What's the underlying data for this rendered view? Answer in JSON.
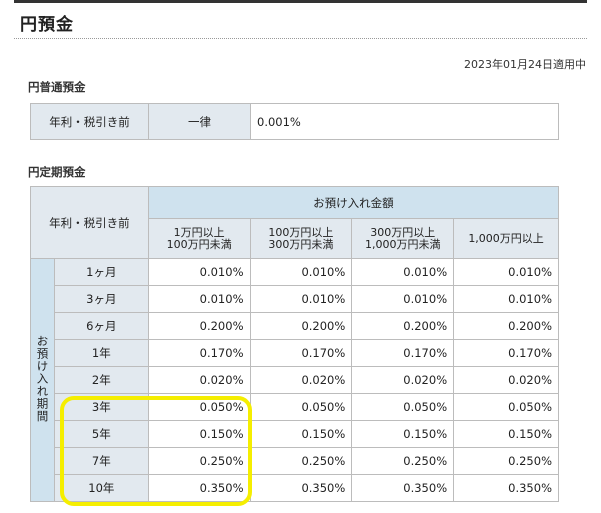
{
  "page": {
    "title": "円預金",
    "as_of": "2023年01月24日適用中"
  },
  "futsuu": {
    "heading": "円普通預金",
    "label": "年利・税引き前",
    "uniform_label": "一律",
    "rate": "0.001%"
  },
  "teiki": {
    "heading": "円定期預金",
    "header_label": "年利・税引き前",
    "amount_header": "お預け入れ金額",
    "period_label": "お預け入れ期間",
    "columns": [
      {
        "line1": "1万円以上",
        "line2": "100万円未満"
      },
      {
        "line1": "100万円以上",
        "line2": "300万円未満"
      },
      {
        "line1": "300万円以上",
        "line2": "1,000万円未満"
      },
      {
        "line1": "1,000万円以上",
        "line2": ""
      }
    ],
    "rows": [
      {
        "term": "1ヶ月",
        "rates": [
          "0.010%",
          "0.010%",
          "0.010%",
          "0.010%"
        ]
      },
      {
        "term": "3ヶ月",
        "rates": [
          "0.010%",
          "0.010%",
          "0.010%",
          "0.010%"
        ]
      },
      {
        "term": "6ヶ月",
        "rates": [
          "0.200%",
          "0.200%",
          "0.200%",
          "0.200%"
        ]
      },
      {
        "term": "1年",
        "rates": [
          "0.170%",
          "0.170%",
          "0.170%",
          "0.170%"
        ]
      },
      {
        "term": "2年",
        "rates": [
          "0.020%",
          "0.020%",
          "0.020%",
          "0.020%"
        ]
      },
      {
        "term": "3年",
        "rates": [
          "0.050%",
          "0.050%",
          "0.050%",
          "0.050%"
        ]
      },
      {
        "term": "5年",
        "rates": [
          "0.150%",
          "0.150%",
          "0.150%",
          "0.150%"
        ]
      },
      {
        "term": "7年",
        "rates": [
          "0.250%",
          "0.250%",
          "0.250%",
          "0.250%"
        ]
      },
      {
        "term": "10年",
        "rates": [
          "0.350%",
          "0.350%",
          "0.350%",
          "0.350%"
        ]
      }
    ]
  },
  "colors": {
    "header_light": "#e2e9ef",
    "header_blue": "#cfe2ee",
    "highlight": "#f5ee00"
  }
}
